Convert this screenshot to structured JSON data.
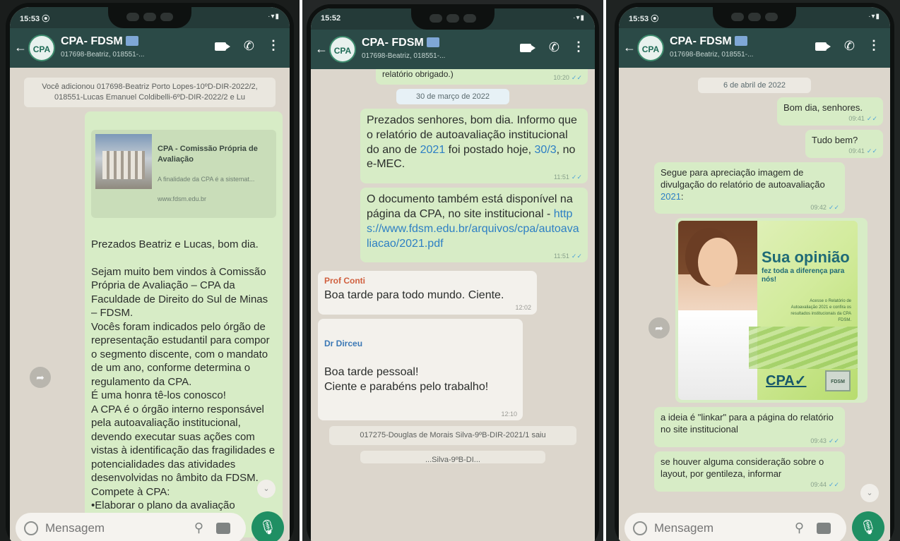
{
  "screens": [
    {
      "status": {
        "time": "15:53 ⦿",
        "icons": "·▾▮"
      },
      "header": {
        "title": "CPA- FDSM",
        "subtitle": "017698-Beatriz, 018551-...",
        "avatar": "CPA"
      },
      "system_message": "Você adicionou 017698-Beatriz Porto Lopes-10ºD-DIR-2022/2, 018551-Lucas Emanuel Coldibelli-6ºD-DIR-2022/2 e Lu",
      "preview": {
        "title": "CPA - Comissão Própria de Avaliação",
        "description": "A finalidade da CPA é a sistemat...",
        "url": "www.fdsm.edu.br"
      },
      "message": "Prezados Beatriz e Lucas, bom dia.\n\nSejam muito bem vindos à Comissão Própria de Avaliação – CPA da Faculdade de Direito do Sul de Minas – FDSM.\nVocês foram indicados pelo órgão de representação estudantil para compor o segmento discente, com o mandato de um ano, conforme determina o regulamento da CPA.\nÉ uma honra tê-los conosco!\nA CPA é o órgão interno responsável pela autoavaliação institucional, devendo executar suas ações com vistas à identificação das fragilidades e potencialidades das atividades desenvolvidas no âmbito da FDSM.  Compete à CPA:\n•Elaborar o plano da avaliação institucional;",
      "input_placeholder": "Mensagem"
    },
    {
      "status": {
        "time": "15:52",
        "icons": "·▾▮"
      },
      "header": {
        "title": "CPA- FDSM",
        "subtitle": "017698-Beatriz, 018551-...",
        "avatar": "CPA"
      },
      "cut_top_message": "relatório obrigado.)",
      "cut_top_time": "10:20",
      "date_chip": "30 de março de 2022",
      "msg1": {
        "before": "Prezados senhores, bom dia. Informo que o relatório de autoavaliação institucional do ano de ",
        "year": "2021",
        "middle": " foi postado hoje, ",
        "date": "30/3",
        "after": ", no e-MEC.",
        "time": "11:51"
      },
      "msg2": {
        "text": "O documento também está disponível na página da CPA, no site institucional - ",
        "link": "https://www.fdsm.edu.br/arquivos/cpa/autoavaliacao/2021.pdf",
        "time": "11:51"
      },
      "msg3": {
        "sender": "Prof Conti",
        "text": "Boa tarde para todo mundo. Ciente.",
        "time": "12:02"
      },
      "msg4": {
        "sender": "Dr Dirceu",
        "text": "Boa tarde pessoal!\nCiente e parabéns pelo trabalho!",
        "time": "12:10"
      },
      "system_bottom": "017275-Douglas de Morais Silva-9ºB-DIR-2021/1 saiu",
      "system_bottom2": "...Silva-9ºB-DI..."
    },
    {
      "status": {
        "time": "15:53 ⦿",
        "icons": "·▾▮"
      },
      "header": {
        "title": "CPA- FDSM",
        "subtitle": "017698-Beatriz, 018551-...",
        "avatar": "CPA"
      },
      "date_chip": "6 de abril de 2022",
      "msg1": {
        "text": "Bom dia, senhores.",
        "time": "09:41"
      },
      "msg2": {
        "text": "Tudo bem?",
        "time": "09:41"
      },
      "msg3": {
        "text": "Segue para apreciação imagem de divulgação do relatório de autoavaliação ",
        "year": "2021",
        "after": ":",
        "time": "09:42"
      },
      "promo": {
        "headline": "Sua opinião",
        "subline": "fez toda a diferença para nós!",
        "small": "Acesse o Relatório de Autoavaliação 2021 e confira os resultados institucionais da CPA FDSM.",
        "logo": "CPA✓",
        "logo2": "FDSM"
      },
      "msg4": {
        "text": "a ideia é \"linkar\" para a página do relatório no site institucional",
        "time": "09:43"
      },
      "msg5": {
        "text": "se houver alguma consideração sobre o layout, por gentileza, informar",
        "time": "09:44"
      },
      "input_placeholder": "Mensagem"
    }
  ]
}
